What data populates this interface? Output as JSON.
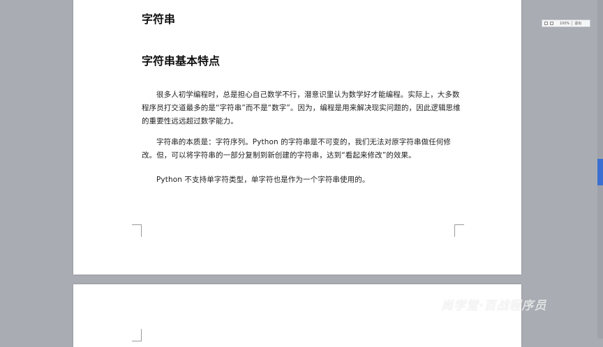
{
  "document": {
    "page1": {
      "heading1": "字符串",
      "heading2": "字符串基本特点",
      "paragraphs": [
        "很多人初学编程时，总是担心自己数学不行，潜意识里认为数学好才能编程。实际上，大多数程序员打交道最多的是“字符串”而不是“数字”。因为，编程是用来解决现实问题的，因此逻辑思维的重要性远远超过数学能力。",
        "字符串的本质是：字符序列。Python 的字符串是不可变的，我们无法对原字符串做任何修改。但，可以将字符串的一部分复制到新创建的字符串，达到“看起来修改”的效果。",
        "Python 不支持单字符类型，单字符也是作为一个字符串使用的。"
      ]
    },
    "page2": {
      "partial_heading": ""
    }
  },
  "toolbar": {
    "zoom": "100%",
    "exit_label": "退出"
  },
  "watermark": "尚学堂·百战程序员",
  "colors": {
    "workspace": "#a9adb3",
    "page": "#ffffff",
    "scroll_thumb": "#3b6fd1"
  }
}
